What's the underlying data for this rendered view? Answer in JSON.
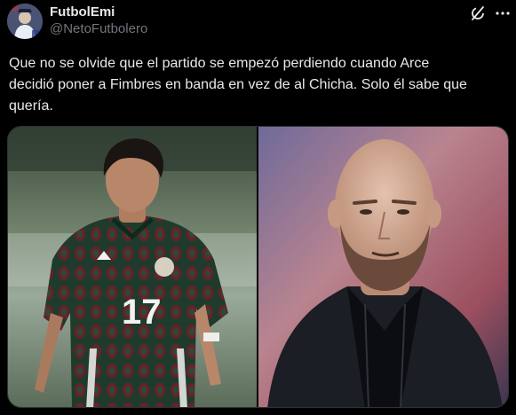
{
  "author": {
    "display_name": "FutbolEmi",
    "handle": "@NetoFutbolero"
  },
  "tweet": {
    "text": "Que no se olvide que el partido se empezó perdiendo cuando Arce\ndecidió poner a Fimbres en banda en vez de al Chicha. Solo él sabe que\nquería."
  },
  "media": {
    "left_photo": {
      "jersey_number": "17",
      "jersey_colors": [
        "#1f3b2b",
        "#6b1f2a",
        "#ffffff"
      ]
    },
    "right_photo": {
      "subject": "bald-bearded-man-black-jacket"
    }
  },
  "icons": {
    "grok": "grok-icon",
    "more": "more-icon"
  },
  "colors": {
    "background": "#000000",
    "text": "#e7e9ea",
    "secondary_text": "#71767b",
    "border": "#2f3336"
  }
}
